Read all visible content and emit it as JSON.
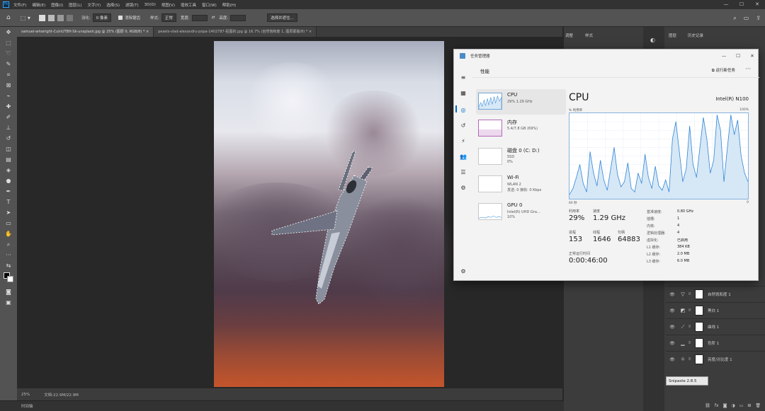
{
  "ps": {
    "menu": [
      "文件(F)",
      "编辑(E)",
      "图像(I)",
      "图层(L)",
      "文字(Y)",
      "选择(S)",
      "滤镜(T)",
      "3D(D)",
      "视图(V)",
      "增效工具",
      "窗口(W)",
      "帮助(H)"
    ],
    "options": {
      "feather_label": "羽化:",
      "feather_value": "0 像素",
      "antialias": "消除锯齿",
      "style_label": "样式:",
      "style_value": "正常",
      "width_label": "宽度:",
      "height_label": "高度:",
      "select_subject": "选择并遮住..."
    },
    "doc_tabs": [
      "samuel-arkwright-CuInUT8H-Sk-unsplash.jpg @ 25% (图层 0, RGB/8) *",
      "pexels-vlad-alexandru-popa-1402787-抠图的.jpg @ 16.7% (自然饱和度 1, 图层蒙版/8) *"
    ],
    "status": {
      "zoom": "25%",
      "doc": "文档:22.9M/22.9M"
    },
    "timeline_label": "时间轴",
    "panels": {
      "adjust_tab": "调整",
      "style_tab": "样式",
      "layers_tab": "图层",
      "history_tab": "历史记录"
    },
    "layers": [
      {
        "name": "自然饱和度 1",
        "icon": "▽"
      },
      {
        "name": "黑白 1",
        "icon": "◩"
      },
      {
        "name": "曲线 1",
        "icon": "⟋"
      },
      {
        "name": "色阶 1",
        "icon": "▁"
      },
      {
        "name": "亮度/对比度 1",
        "icon": "☼"
      }
    ],
    "snipaste": "Snipaste 2.8.5"
  },
  "tm": {
    "title": "任务管理器",
    "section": "性能",
    "run_task": "运行新任务",
    "resources": [
      {
        "name": "CPU",
        "sub1": "29% 1.29 GHz",
        "sub2": ""
      },
      {
        "name": "内存",
        "sub1": "5.4/7.8 GB (69%)",
        "sub2": ""
      },
      {
        "name": "磁盘 0 (C: D:)",
        "sub1": "SSD",
        "sub2": "0%"
      },
      {
        "name": "Wi-Fi",
        "sub1": "WLAN 2",
        "sub2": "发送: 0 接收: 0 Kbps"
      },
      {
        "name": "GPU 0",
        "sub1": "Intel(R) UHD Gra...",
        "sub2": "10%"
      }
    ],
    "cpu": {
      "heading": "CPU",
      "model": "Intel(R) N100",
      "graph_label": "% 利用率",
      "graph_max": "100%",
      "graph_time": "60 秒",
      "graph_min": "0",
      "stats": {
        "util_label": "利用率",
        "util_value": "29%",
        "speed_label": "速度",
        "speed_value": "1.29 GHz",
        "proc_label": "进程",
        "proc_value": "153",
        "thread_label": "线程",
        "thread_value": "1646",
        "handle_label": "句柄",
        "handle_value": "64883",
        "uptime_label": "正常运行时间",
        "uptime_value": "0:00:46:00"
      },
      "specs": [
        {
          "k": "基准速度:",
          "v": "0.80 GHz"
        },
        {
          "k": "插槽:",
          "v": "1"
        },
        {
          "k": "内核:",
          "v": "4"
        },
        {
          "k": "逻辑处理器:",
          "v": "4"
        },
        {
          "k": "虚拟化:",
          "v": "已启用"
        },
        {
          "k": "L1 缓存:",
          "v": "384 KB"
        },
        {
          "k": "L2 缓存:",
          "v": "2.0 MB"
        },
        {
          "k": "L3 缓存:",
          "v": "6.0 MB"
        }
      ]
    }
  },
  "chart_data": {
    "type": "area",
    "xlim": [
      60,
      0
    ],
    "ylim": [
      0,
      100
    ],
    "xlabel": "60 秒",
    "ylabel": "% 利用率",
    "values": [
      5,
      12,
      25,
      40,
      18,
      8,
      55,
      30,
      15,
      45,
      22,
      10,
      35,
      60,
      28,
      14,
      20,
      42,
      12,
      8,
      30,
      18,
      52,
      25,
      12,
      38,
      15,
      10,
      22,
      8,
      70,
      90,
      55,
      20,
      35,
      85,
      40,
      25,
      60,
      95,
      70,
      30,
      45,
      98,
      80,
      20,
      60,
      98,
      75,
      92,
      50,
      30,
      20
    ]
  }
}
